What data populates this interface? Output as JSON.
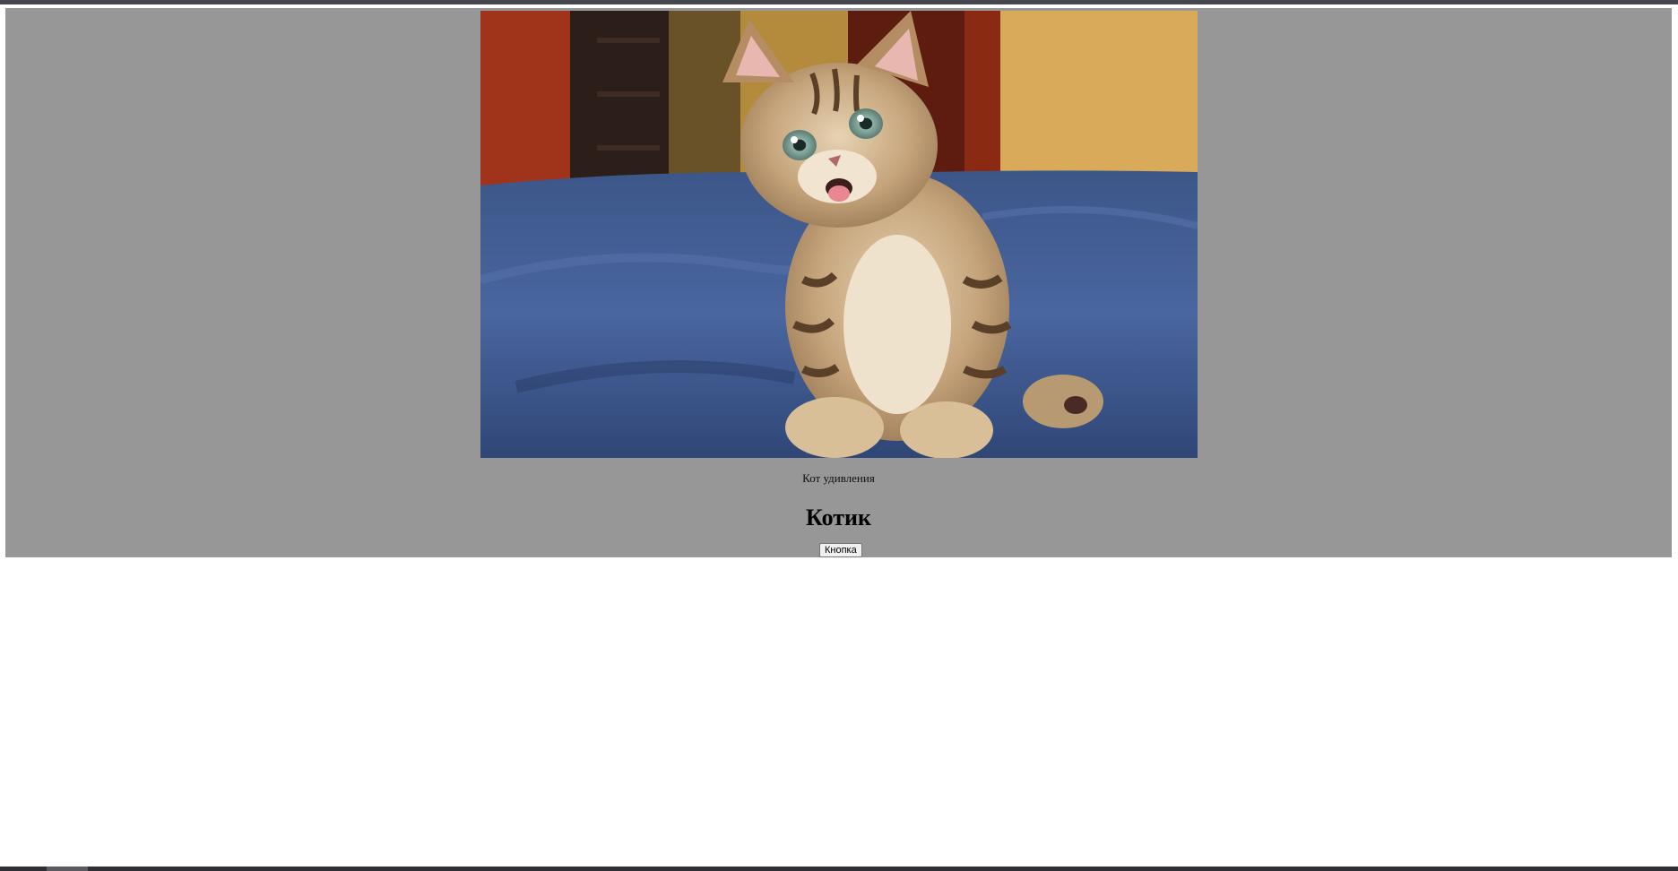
{
  "image": {
    "alt_icon": "kitten-photo"
  },
  "caption": "Кот удивления",
  "heading": "Котик",
  "button_label": "Кнопка",
  "colors": {
    "panel_background": "#979797",
    "page_background": "#ffffff"
  }
}
